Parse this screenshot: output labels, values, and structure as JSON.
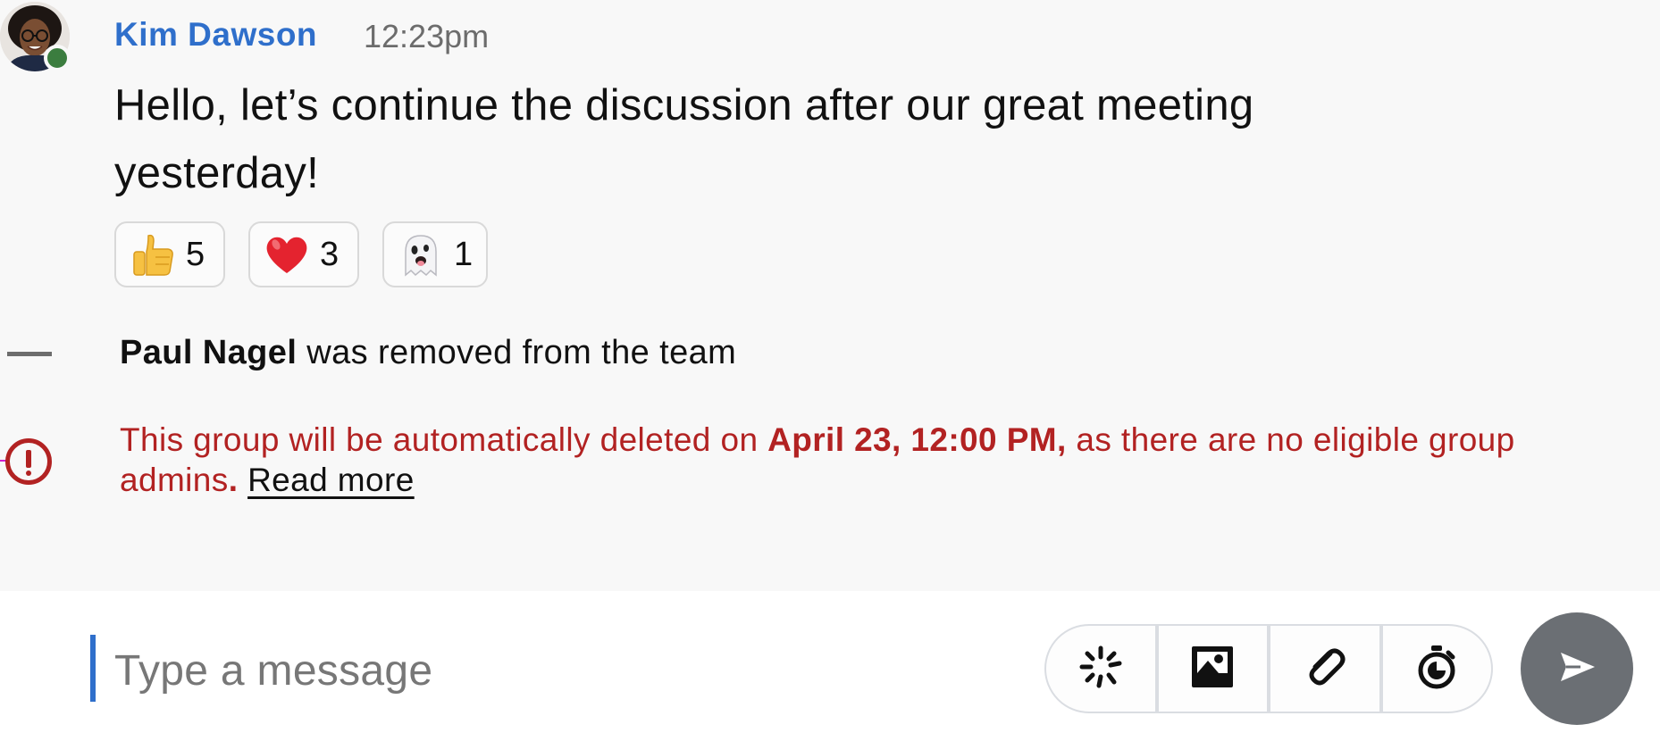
{
  "message": {
    "author": "Kim Dawson",
    "time": "12:23pm",
    "text": "Hello, let’s continue the discussion after our great meeting yesterday!",
    "presence_color": "#3b7d3f",
    "reactions": [
      {
        "emoji": "thumbs-up",
        "count": "5"
      },
      {
        "emoji": "red-heart",
        "count": "3"
      },
      {
        "emoji": "ghost",
        "count": "1"
      }
    ]
  },
  "system_event": {
    "name": "Paul Nagel",
    "text": " was removed from the team"
  },
  "warning": {
    "prefix": "This group will be automatically deleted on ",
    "date": "April 23, 12:00 PM,",
    "suffix": " as there are no eligible group admins",
    "period": ".",
    "link": "Read more",
    "color": "#b22222"
  },
  "composer": {
    "placeholder": "Type a message",
    "tools": [
      "sparkle-icon",
      "image-icon",
      "paperclip-icon",
      "timer-icon"
    ],
    "send_icon": "send-icon"
  },
  "colors": {
    "accent": "#2f6fcb",
    "send_button": "#6b6f74"
  }
}
